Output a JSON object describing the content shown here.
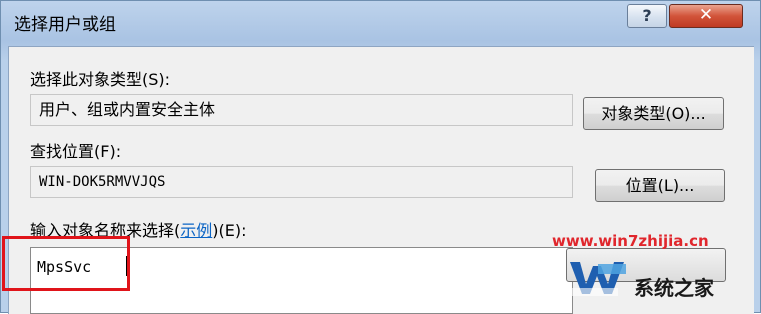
{
  "window": {
    "title": "选择用户或组",
    "help_label": "?",
    "close_label": "✕"
  },
  "object_type": {
    "label": "选择此对象类型(S):",
    "value": "用户、组或内置安全主体",
    "button_label": "对象类型(O)..."
  },
  "location": {
    "label": "查找位置(F):",
    "value": "WIN-DOK5RMVVJQS",
    "button_label": "位置(L)..."
  },
  "names": {
    "label_prefix": "输入对象名称来选择(",
    "label_link": "示例",
    "label_suffix": ")(E):",
    "value": "MpsSvc"
  },
  "watermark": {
    "url": "www.win7zhijia.cn",
    "brand": "系统之家",
    "logo_icon": "windows-w-logo-icon"
  },
  "colors": {
    "highlight_box": "#e0141a",
    "link": "#0b64c5",
    "watermark_url": "#e0262c"
  }
}
